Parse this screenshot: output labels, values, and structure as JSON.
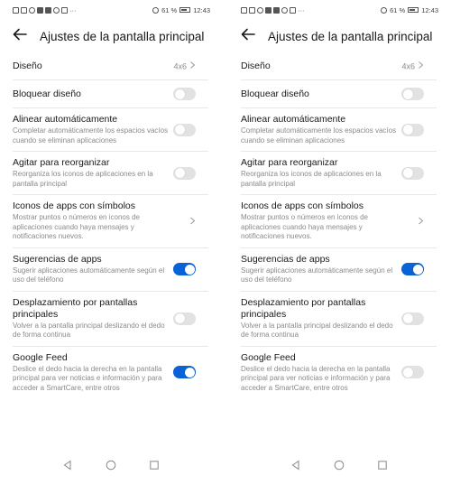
{
  "status": {
    "battery_text": "61 %",
    "time": "12:43",
    "overflow": "···"
  },
  "screens": [
    {
      "title": "Ajustes de la pantalla principal",
      "items": [
        {
          "title": "Diseño",
          "value": "4x6"
        },
        {
          "title": "Bloquear diseño",
          "toggle": false
        },
        {
          "title": "Alinear automáticamente",
          "subtitle": "Completar automáticamente los espacios vacíos cuando se eliminan aplicaciones",
          "toggle": false
        },
        {
          "title": "Agitar para reorganizar",
          "subtitle": "Reorganiza los iconos de aplicaciones en la pantalla principal",
          "toggle": false
        },
        {
          "title": "Iconos de apps con símbolos",
          "subtitle": "Mostrar puntos o números en iconos de aplicaciones cuando haya mensajes y notificaciones nuevos."
        },
        {
          "title": "Sugerencias de apps",
          "subtitle": "Sugerir aplicaciones automáticamente según el uso del teléfono",
          "toggle": true
        },
        {
          "title": "Desplazamiento por pantallas principales",
          "subtitle": "Volver a la pantalla principal deslizando el dedo de forma continua",
          "toggle": false
        },
        {
          "title": "Google Feed",
          "subtitle": "Deslice el dedo hacia la derecha en la pantalla principal para ver noticias e información y para acceder a SmartCare, entre otros",
          "toggle": true
        }
      ]
    },
    {
      "title": "Ajustes de la pantalla principal",
      "items": [
        {
          "title": "Diseño",
          "value": "4x6"
        },
        {
          "title": "Bloquear diseño",
          "toggle": false
        },
        {
          "title": "Alinear automáticamente",
          "subtitle": "Completar automáticamente los espacios vacíos cuando se eliminan aplicaciones",
          "toggle": false
        },
        {
          "title": "Agitar para reorganizar",
          "subtitle": "Reorganiza los iconos de aplicaciones en la pantalla principal",
          "toggle": false
        },
        {
          "title": "Iconos de apps con símbolos",
          "subtitle": "Mostrar puntos o números en iconos de aplicaciones cuando haya mensajes y notificaciones nuevos."
        },
        {
          "title": "Sugerencias de apps",
          "subtitle": "Sugerir aplicaciones automáticamente según el uso del teléfono",
          "toggle": true
        },
        {
          "title": "Desplazamiento por pantallas principales",
          "subtitle": "Volver a la pantalla principal deslizando el dedo de forma continua",
          "toggle": false
        },
        {
          "title": "Google Feed",
          "subtitle": "Deslice el dedo hacia la derecha en la pantalla principal para ver noticias e información y para acceder a SmartCare, entre otros",
          "toggle": false
        }
      ]
    }
  ],
  "colors": {
    "toggle_on": "#0a63d6",
    "toggle_off": "#e2e2e2"
  }
}
